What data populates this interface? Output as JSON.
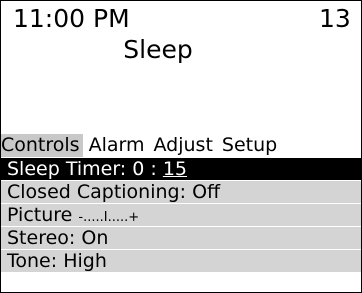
{
  "status": {
    "time": "11:00 PM",
    "channel": "13"
  },
  "menu": {
    "title": "Sleep"
  },
  "tabs": [
    {
      "label": "Controls",
      "selected": true
    },
    {
      "label": "Alarm",
      "selected": false
    },
    {
      "label": "Adjust",
      "selected": false
    },
    {
      "label": "Setup",
      "selected": false
    }
  ],
  "items": {
    "sleep_timer": {
      "label": "Sleep Timer:",
      "hours": "0",
      "separator": ":",
      "minutes": "15"
    },
    "closed_captioning": {
      "label": "Closed Captioning:",
      "value": "Off"
    },
    "picture": {
      "label": "Picture",
      "minus": "-",
      "left_dots": ".....",
      "marker": "I",
      "right_dots": ".....",
      "plus": "+",
      "level": 0.5
    },
    "stereo": {
      "label": "Stereo:",
      "value": "On"
    },
    "tone": {
      "label": "Tone:",
      "value": "High"
    }
  },
  "colors": {
    "selected_item_bg": "#000000",
    "selected_item_fg": "#ffffff",
    "item_bg": "#d4d4d4",
    "selected_tab_bg": "#c8c8c8"
  }
}
